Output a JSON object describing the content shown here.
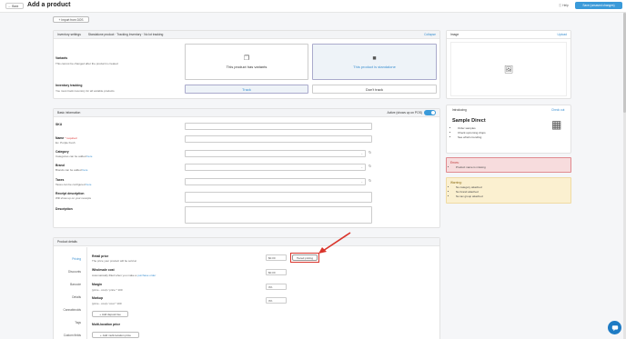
{
  "header": {
    "back_label": "Back",
    "title": "Add a product",
    "help_label": "Help",
    "save_label": "Save (unsaved changes)"
  },
  "import_label": "Import from DOS",
  "inventory": {
    "head_label": "Inventory settings",
    "head_summary": "Standalone product · Tracking Inventory · No lot tracking",
    "collapse_label": "Collapse",
    "variants_title": "Variants",
    "variants_desc": "This cannot be changed after the product is created",
    "opt_variants": "This product has variants",
    "opt_standalone": "This product is standalone",
    "tracking_title": "Inventory tracking",
    "tracking_desc": "You must track inventory for all variable products",
    "track_label": "Track",
    "donttrack_label": "Don't track"
  },
  "image": {
    "title": "Image",
    "upload_label": "Upload"
  },
  "basic": {
    "title": "Basic information",
    "active_label": "Active (shows up on POS)",
    "sku_label": "SKU",
    "name_label": "Name",
    "required_label": "* required",
    "name_hint": "Ex. Purple Kush",
    "category_label": "Category",
    "category_hint_pre": "Categories can be added",
    "brand_label": "Brand",
    "brand_hint_pre": "Brands can be added",
    "taxes_label": "Taxes",
    "taxes_hint_pre": "Taxes can be configured",
    "here": "here",
    "receipt_label": "Receipt description",
    "receipt_hint": "Will show up on your receipts",
    "desc_label": "Description"
  },
  "introducing": {
    "title": "Introducing",
    "checkout_label": "Check out",
    "brand": "Sample Direct",
    "items": [
      "Order samples",
      "Check upcoming drops",
      "See what's trending"
    ]
  },
  "errors": {
    "title": "Errors:",
    "items": [
      "Product name is missing"
    ]
  },
  "warnings": {
    "title": "Warning:",
    "items": [
      "No category attached",
      "No brand attached",
      "No tax group attached"
    ]
  },
  "details": {
    "title": "Product details",
    "nav": [
      "Pricing",
      "Discounts",
      "Barcode",
      "Details",
      "Cannabinoids",
      "Tags",
      "Custom fields"
    ],
    "retail_label": "Retail price",
    "retail_hint": "The price your product will be sold at",
    "retail_value": "$0.00",
    "tiered_label": "Tiered pricing",
    "wholesale_label": "Wholesale cost",
    "wholesale_hint_pre": "Automatically filled when you make a",
    "wholesale_hint_link": "purchase order",
    "wholesale_value": "$0.00",
    "margin_label": "Margin",
    "margin_formula": "(price - cost) / price * 100",
    "margin_value": "0%",
    "markup_label": "Markup",
    "markup_formula": "(price - cost) / cost * 100",
    "markup_value": "0%",
    "deposit_label": "Add deposit fee",
    "multiloc_label": "Multi-location price",
    "multiloc_btn": "Add multi-location price"
  }
}
